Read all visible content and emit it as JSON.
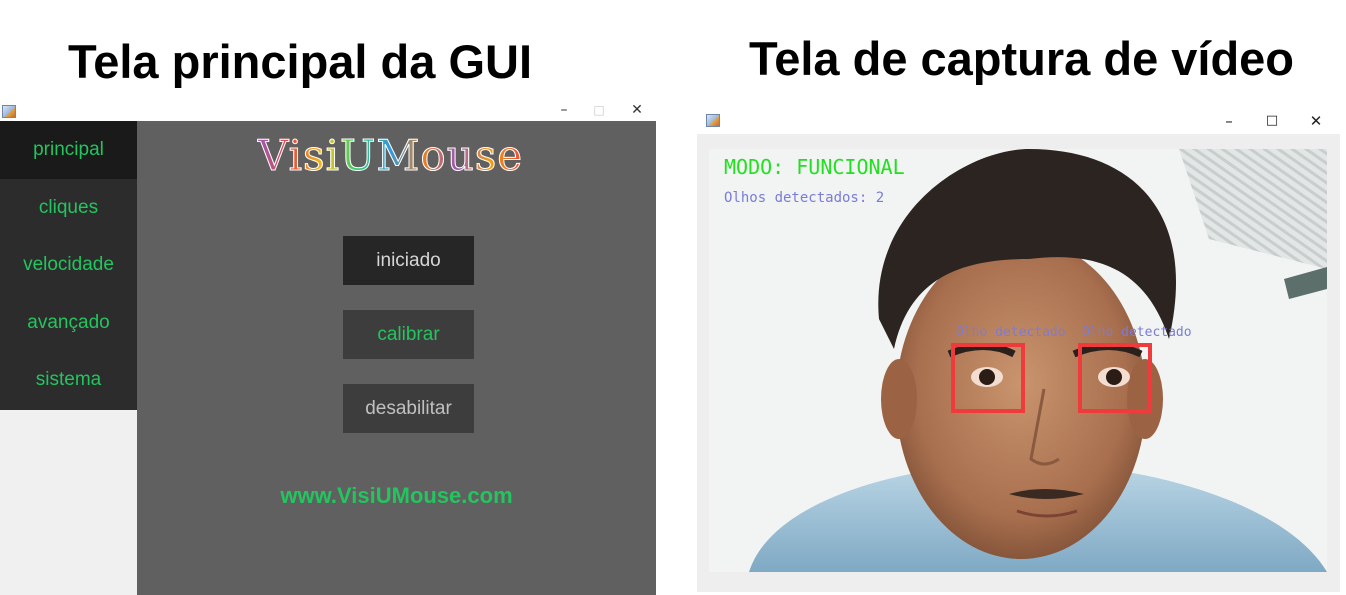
{
  "left_title": "Tela principal da GUI",
  "right_title": "Tela de captura de vídeo",
  "gui": {
    "logo": "VisiUMouse",
    "nav": [
      "principal",
      "cliques",
      "velocidade",
      "avançado",
      "sistema"
    ],
    "buttons": {
      "iniciado": "iniciado",
      "calibrar": "calibrar",
      "desabilitar": "desabilitar"
    },
    "website": "www.VisiUMouse.com",
    "window_controls": {
      "minimize": "–",
      "maximize": "□",
      "close": "✕"
    }
  },
  "video": {
    "mode": "MODO: FUNCIONAL",
    "eyes_detected": "Olhos detectados: 2",
    "eye_labels": [
      "Olho detectado",
      "Olho detectado"
    ],
    "window_controls": {
      "minimize": "–",
      "maximize": "□",
      "close": "✕"
    }
  },
  "colors": {
    "accent_green": "#22c55e",
    "overlay_green": "#22e01f",
    "overlay_blue": "#7b7bd8",
    "eye_box_red": "#ef3b3b"
  }
}
